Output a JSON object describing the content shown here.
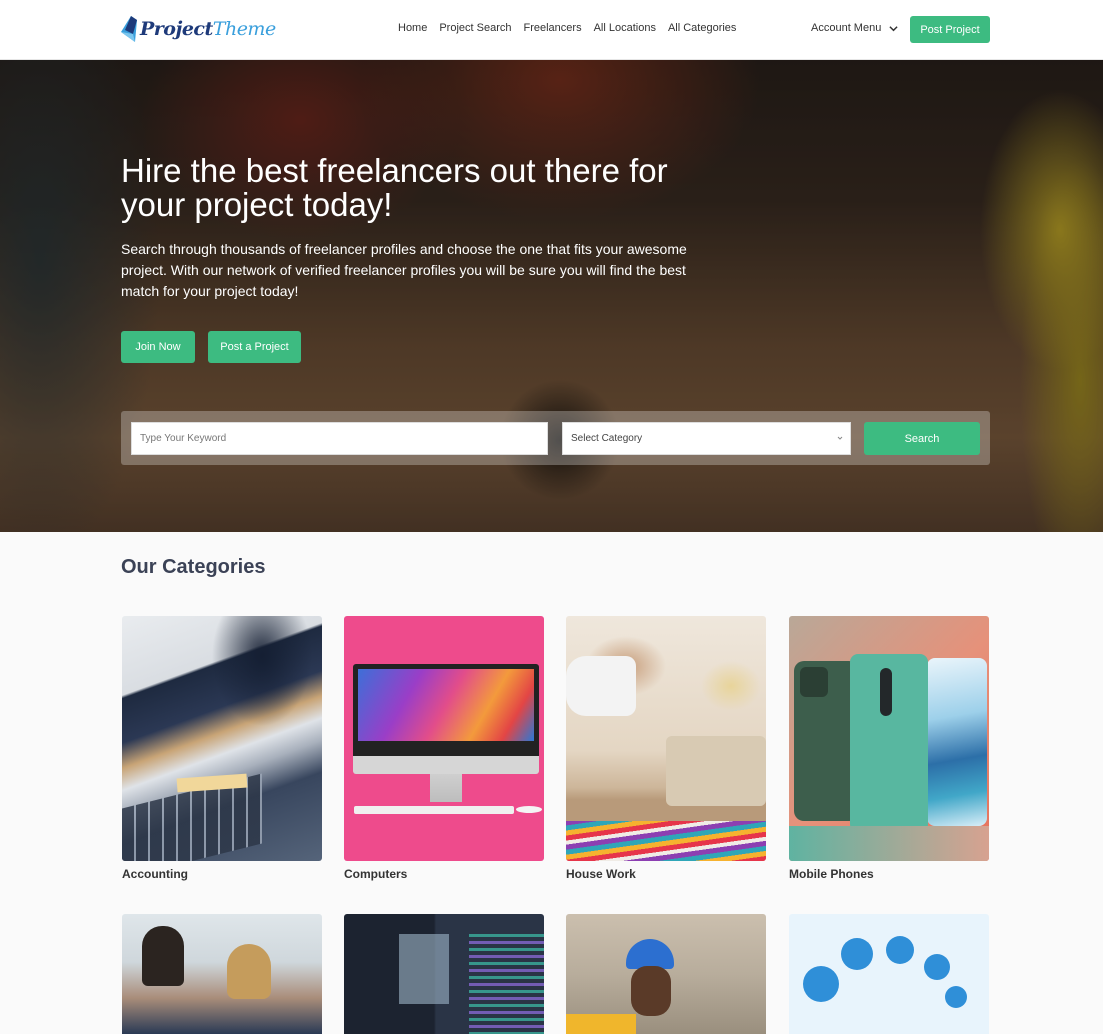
{
  "header": {
    "logo": {
      "part1": "Project",
      "part2": "Theme"
    },
    "nav": [
      {
        "label": "Home"
      },
      {
        "label": "Project Search"
      },
      {
        "label": "Freelancers"
      },
      {
        "label": "All Locations"
      },
      {
        "label": "All Categories"
      }
    ],
    "account_menu": "Account Menu",
    "post_project": "Post Project"
  },
  "hero": {
    "title": "Hire the best freelancers out there for your project today!",
    "subtitle": "Search through thousands of freelancer profiles and choose the one that fits your awesome project. With our network of verified freelancer profiles you will be sure you will find the best match for your project today!",
    "join_button": "Join Now",
    "post_button": "Post a Project",
    "search": {
      "keyword_placeholder": "Type Your Keyword",
      "category_selected": "Select Category",
      "search_button": "Search"
    }
  },
  "categories": {
    "title": "Our Categories",
    "items": [
      {
        "label": "Accounting",
        "image": "accounting-photo"
      },
      {
        "label": "Computers",
        "image": "imac-photo"
      },
      {
        "label": "House Work",
        "image": "vacuuming-photo"
      },
      {
        "label": "Mobile Phones",
        "image": "smartphones-photo"
      },
      {
        "label": "",
        "image": "team-meeting-photo"
      },
      {
        "label": "",
        "image": "code-editor-photo"
      },
      {
        "label": "",
        "image": "construction-worker-photo"
      },
      {
        "label": "",
        "image": "pc-tools-illustration"
      }
    ]
  },
  "colors": {
    "accent_green": "#3dbb81",
    "heading": "#3b4256",
    "logo_dark": "#1e3a7a",
    "logo_light": "#3a9fdc"
  }
}
